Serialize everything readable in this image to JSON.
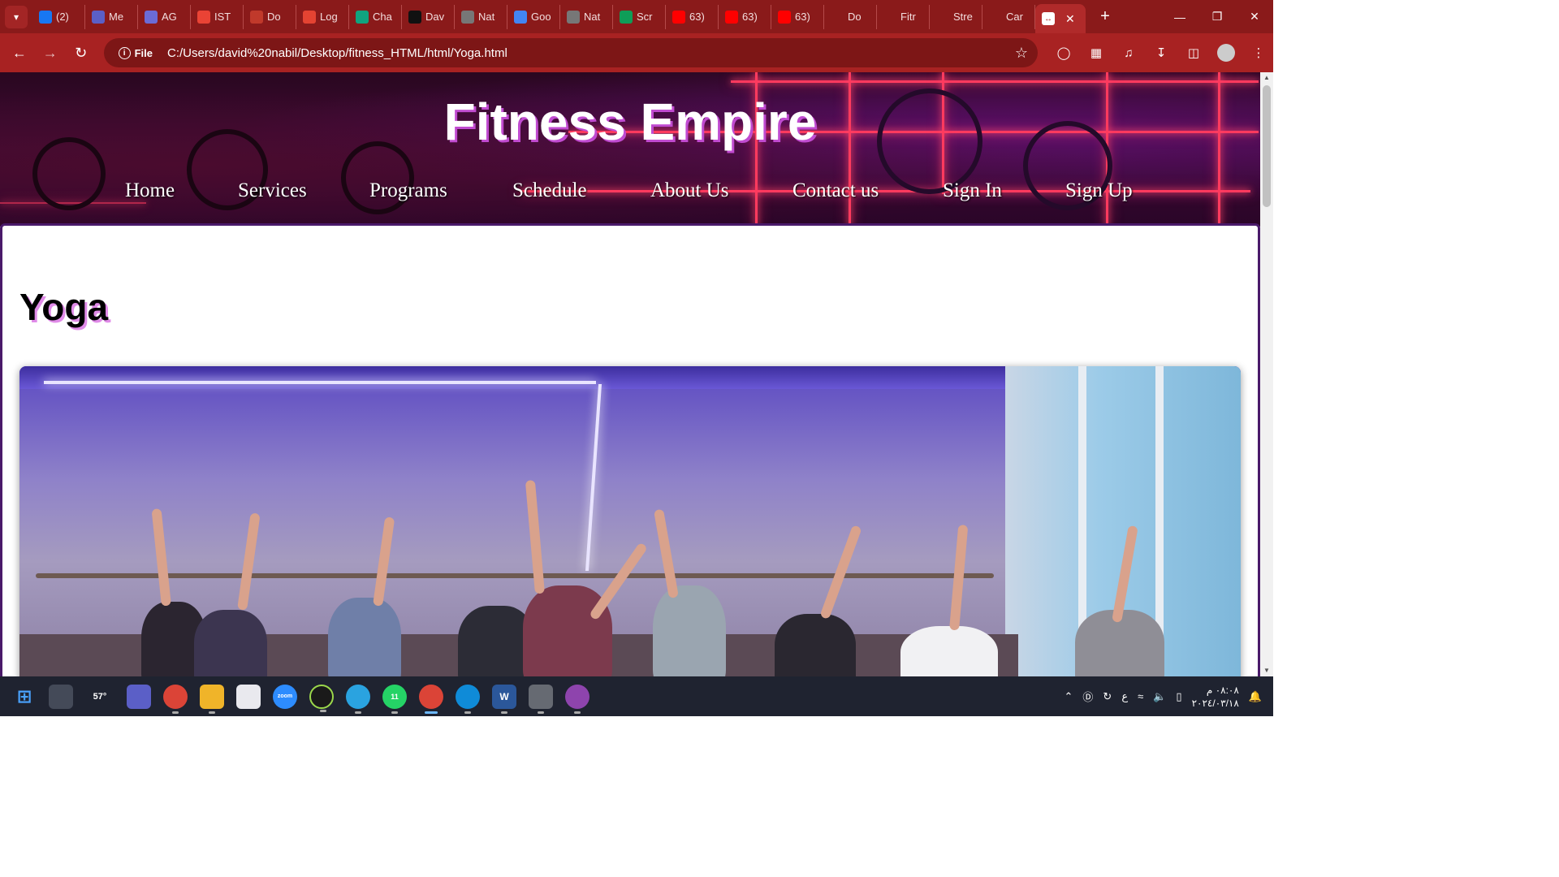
{
  "browser": {
    "tabs": [
      {
        "label": "(2)",
        "icon": "facebook-icon",
        "color": "#1877f2"
      },
      {
        "label": "Me",
        "icon": "teams-icon",
        "color": "#5b5fc7"
      },
      {
        "label": "AG",
        "icon": "chat-icon",
        "color": "#6b6bd6"
      },
      {
        "label": "IST",
        "icon": "gmail-icon",
        "color": "#ea4335"
      },
      {
        "label": "Do",
        "icon": "record-icon",
        "color": "#c0392b"
      },
      {
        "label": "Log",
        "icon": "todoist-icon",
        "color": "#e44332"
      },
      {
        "label": "Cha",
        "icon": "chatgpt-icon",
        "color": "#10a37f"
      },
      {
        "label": "Dav",
        "icon": "github-icon",
        "color": "#111111"
      },
      {
        "label": "Nat",
        "icon": "globe-icon",
        "color": "#777777"
      },
      {
        "label": "Goo",
        "icon": "translate-icon",
        "color": "#4285f4"
      },
      {
        "label": "Nat",
        "icon": "globe-icon",
        "color": "#777777"
      },
      {
        "label": "Scr",
        "icon": "drive-icon",
        "color": "#0f9d58"
      },
      {
        "label": "63)",
        "icon": "youtube-icon",
        "color": "#ff0000"
      },
      {
        "label": "63)",
        "icon": "youtube-icon",
        "color": "#ff0000"
      },
      {
        "label": "63)",
        "icon": "youtube-icon",
        "color": "#ff0000"
      },
      {
        "label": "Do",
        "icon": "download-icon",
        "color": "#8a1a1a"
      },
      {
        "label": "Fitr",
        "icon": "arrows-icon",
        "color": "#8a1a1a"
      },
      {
        "label": "Stre",
        "icon": "arrows-icon",
        "color": "#8a1a1a"
      },
      {
        "label": "Car",
        "icon": "arrows-icon",
        "color": "#8a1a1a"
      }
    ],
    "address_chip": "File",
    "url": "C:/Users/david%20nabil/Desktop/fitness_HTML/html/Yoga.html"
  },
  "page": {
    "brand": "Fitness Empire",
    "nav": [
      "Home",
      "Services",
      "Programs",
      "Schedule",
      "About Us",
      "Contact us",
      "Sign In",
      "Sign Up"
    ],
    "title": "Yoga",
    "hero_image": "yoga-class-photo",
    "colors": {
      "brand_shadow": "#c04bd0",
      "title_shadow": "#e08be8",
      "neon": "#ff3a5e"
    }
  },
  "taskbar": {
    "weather": "57°",
    "whatsapp_badge": "11",
    "lang": "ع",
    "time": "٠٨:٠٨ م",
    "date": "٢٠٢٤/٠٣/١٨"
  }
}
